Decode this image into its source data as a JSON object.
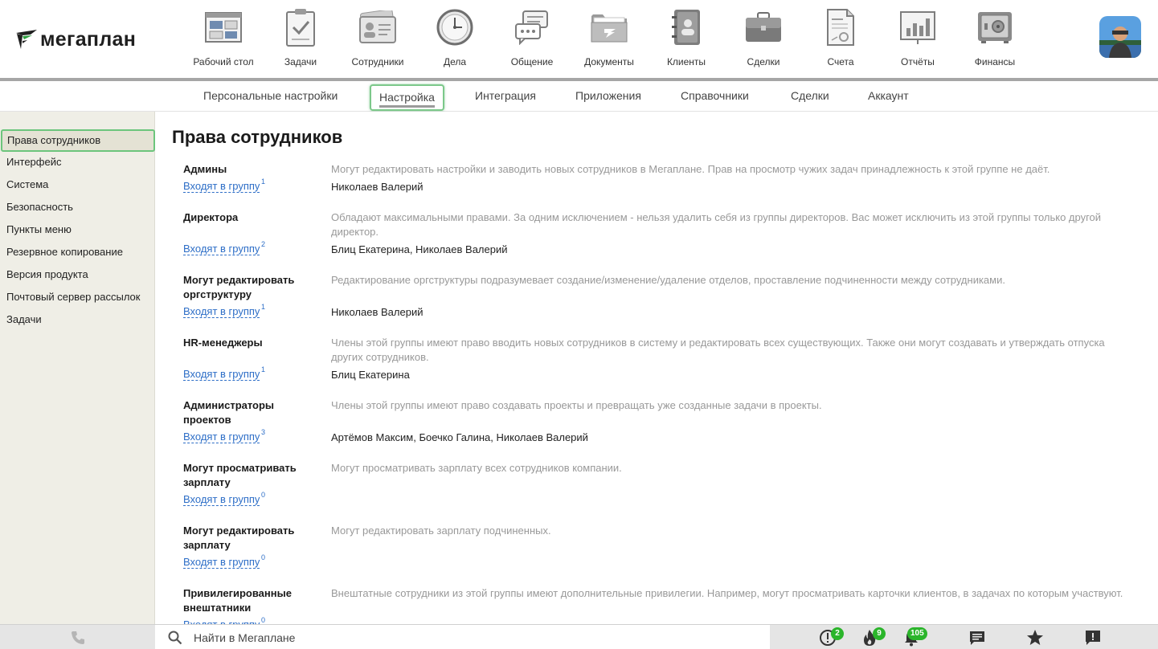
{
  "logo": {
    "text": "мегаплан",
    "accent_color": "#2e9e3e"
  },
  "modules": [
    {
      "label": "Рабочий стол",
      "icon": "dashboard-icon"
    },
    {
      "label": "Задачи",
      "icon": "tasks-clipboard-icon"
    },
    {
      "label": "Сотрудники",
      "icon": "employees-card-icon"
    },
    {
      "label": "Дела",
      "icon": "clock-icon"
    },
    {
      "label": "Общение",
      "icon": "chat-bubbles-icon"
    },
    {
      "label": "Документы",
      "icon": "folder-icon"
    },
    {
      "label": "Клиенты",
      "icon": "contacts-book-icon"
    },
    {
      "label": "Сделки",
      "icon": "briefcase-icon"
    },
    {
      "label": "Счета",
      "icon": "invoice-icon"
    },
    {
      "label": "Отчёты",
      "icon": "report-chart-icon"
    },
    {
      "label": "Финансы",
      "icon": "safe-icon"
    }
  ],
  "tabs": [
    {
      "label": "Персональные настройки",
      "active": false
    },
    {
      "label": "Настройка",
      "active": true
    },
    {
      "label": "Интеграция",
      "active": false
    },
    {
      "label": "Приложения",
      "active": false
    },
    {
      "label": "Справочники",
      "active": false
    },
    {
      "label": "Сделки",
      "active": false
    },
    {
      "label": "Аккаунт",
      "active": false
    }
  ],
  "sidebar": {
    "items": [
      {
        "label": "Права сотрудников",
        "active": true
      },
      {
        "label": "Интерфейс",
        "active": false
      },
      {
        "label": "Система",
        "active": false
      },
      {
        "label": "Безопасность",
        "active": false
      },
      {
        "label": "Пункты меню",
        "active": false
      },
      {
        "label": "Резервное копирование",
        "active": false
      },
      {
        "label": "Версия продукта",
        "active": false
      },
      {
        "label": "Почтовый сервер рассылок",
        "active": false
      },
      {
        "label": "Задачи",
        "active": false
      }
    ]
  },
  "main": {
    "title": "Права сотрудников",
    "link_label": "Входят в группу",
    "groups": [
      {
        "name": "Админы",
        "description": "Могут редактировать настройки и заводить новых сотрудников в Мегаплане. Прав на просмотр чужих задач принадлежность к этой группе не даёт.",
        "count": "1",
        "members": "Николаев Валерий"
      },
      {
        "name": "Директора",
        "description": "Обладают максимальными правами. За одним исключением - нельзя удалить себя из группы директоров. Вас может исключить из этой группы только другой директор.",
        "count": "2",
        "members": "Блиц Екатерина, Николаев Валерий"
      },
      {
        "name": "Могут редактировать оргструктуру",
        "description": "Редактирование оргструктуры подразумевает создание/изменение/удаление отделов, проставление подчиненности между сотрудниками.",
        "count": "1",
        "members": "Николаев Валерий"
      },
      {
        "name": "HR-менеджеры",
        "description": "Члены этой группы имеют право вводить новых сотрудников в систему и редактировать всех существующих. Также они могут создавать и утверждать отпуска других сотрудников.",
        "count": "1",
        "members": "Блиц Екатерина"
      },
      {
        "name": "Администраторы проектов",
        "description": "Члены этой группы имеют право создавать проекты и превращать уже созданные задачи в проекты.",
        "count": "3",
        "members": "Артёмов Максим, Боечко Галина, Николаев Валерий"
      },
      {
        "name": "Могут просматривать зарплату",
        "description": "Могут просматривать зарплату всех сотрудников компании.",
        "count": "0",
        "members": ""
      },
      {
        "name": "Могут редактировать зарплату",
        "description": "Могут редактировать зарплату подчиненных.",
        "count": "0",
        "members": ""
      },
      {
        "name": "Привилегированные внештатники",
        "description": "Внештатные сотрудники из этой группы имеют дополнительные привилегии. Например, могут просматривать карточки клиентов, в задачах по которым участвуют.",
        "count": "0",
        "members": ""
      }
    ]
  },
  "bottombar": {
    "search_placeholder": "Найти в Мегаплане",
    "badges": {
      "alerts": "2",
      "hot": "9",
      "notifications": "105"
    },
    "badge_color": "#2bb52b"
  }
}
